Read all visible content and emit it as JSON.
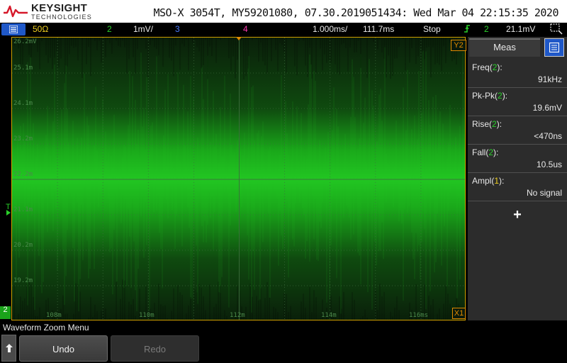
{
  "header": {
    "brand": "KEYSIGHT",
    "brand_sub": "TECHNOLOGIES",
    "title": "MSO-X 3054T, MY59201080, 07.30.2019051434: Wed Mar 04 22:15:35 2020"
  },
  "status": {
    "impedance": "50Ω",
    "ch2_label": "2",
    "ch2_scale": "1mV/",
    "ch3_label": "3",
    "ch4_label": "4",
    "timebase": "1.000ms/",
    "delay": "111.7ms",
    "run_state": "Stop",
    "trigger_channel": "2",
    "trigger_level": "21.1mV"
  },
  "screen": {
    "y_labels": [
      "26.2mV",
      "25.1m",
      "24.1m",
      "23.2m",
      "22.2m",
      "21.1m",
      "20.2m",
      "19.2m"
    ],
    "x_labels": [
      "108m",
      "110m",
      "112m",
      "114m",
      "116ms"
    ],
    "marker_y2": "Y2",
    "marker_x1": "X1",
    "marker_channel": "2",
    "marker_trigger": "T",
    "colors": {
      "trace": "#22c622",
      "grid": "#3d6b3d",
      "marker": "#e08a00"
    }
  },
  "measurements": {
    "tab_label": "Meas",
    "items": [
      {
        "name": "Freq",
        "channel": "2",
        "value": "91kHz"
      },
      {
        "name": "Pk-Pk",
        "channel": "2",
        "value": "19.6mV"
      },
      {
        "name": "Rise",
        "channel": "2",
        "value": "<470ns"
      },
      {
        "name": "Fall",
        "channel": "2",
        "value": "10.5us"
      },
      {
        "name": "Ampl",
        "channel": "1",
        "value": "No signal"
      }
    ],
    "add_label": "+"
  },
  "softkeys": {
    "menu_title": "Waveform Zoom Menu",
    "undo": "Undo",
    "redo": "Redo"
  }
}
